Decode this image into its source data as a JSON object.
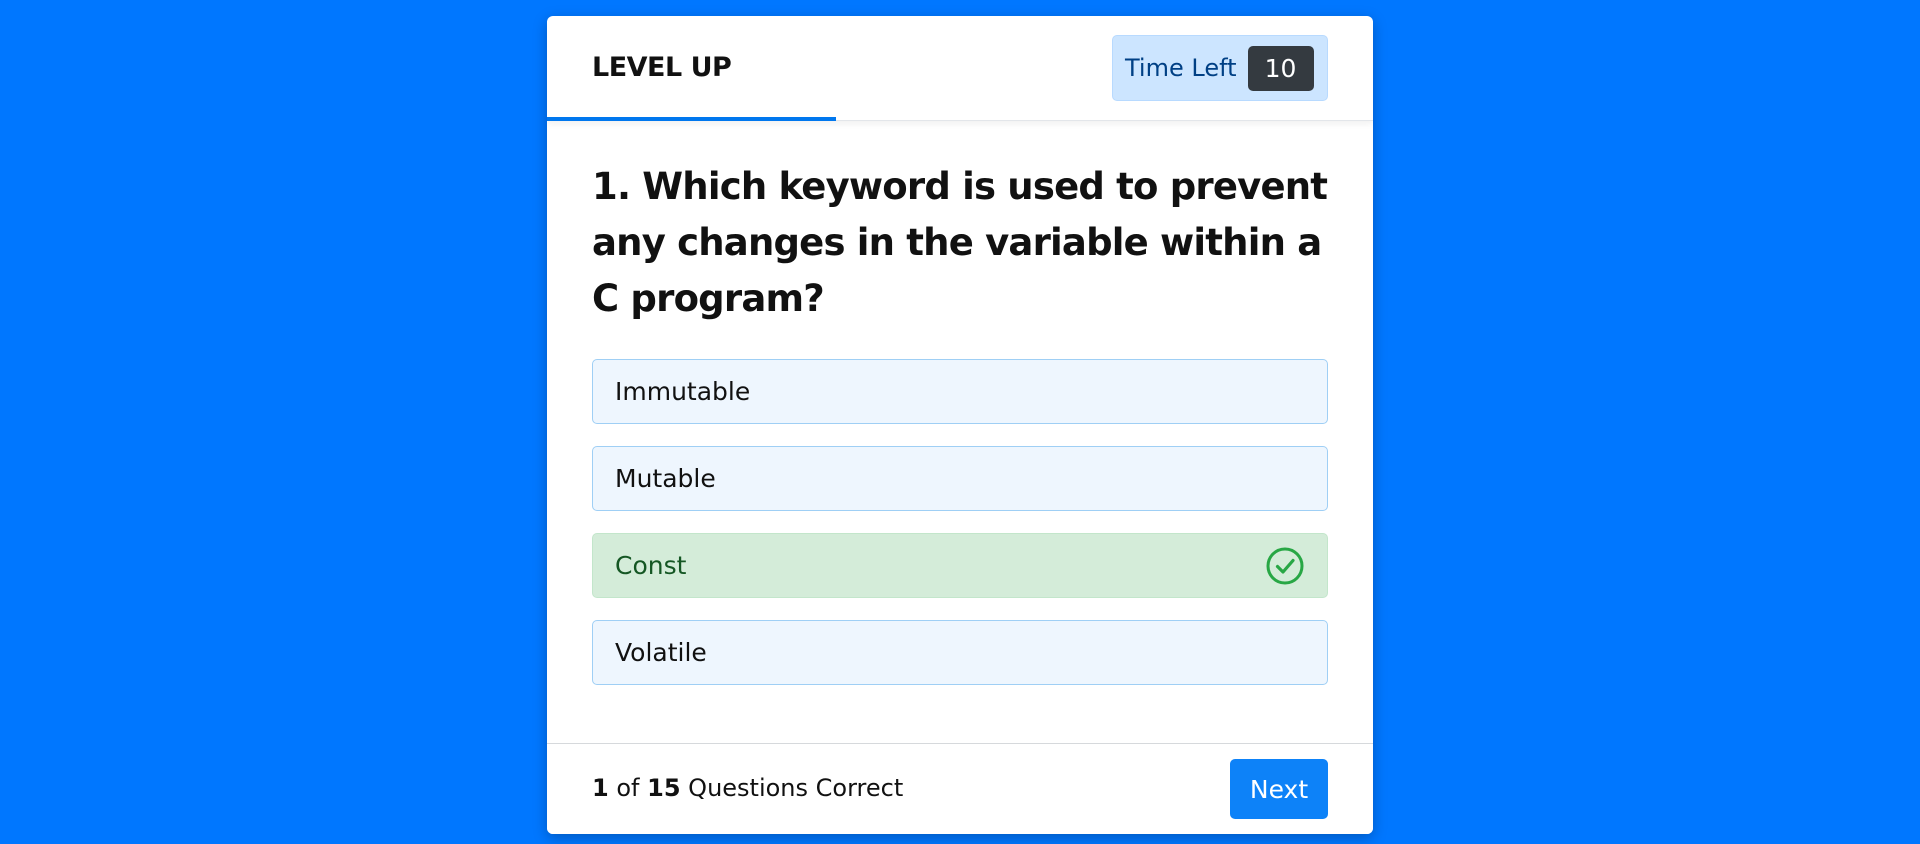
{
  "header": {
    "brand": "LEVEL UP",
    "timer_label": "Time Left",
    "timer_value": "10",
    "time_progress_fraction": 0.35
  },
  "question": {
    "text": "1. Which keyword is used to prevent any changes in the variable within a C program?"
  },
  "options": [
    {
      "label": "Immutable",
      "state": "default"
    },
    {
      "label": "Mutable",
      "state": "default"
    },
    {
      "label": "Const",
      "state": "correct",
      "icon": "check-circle-icon"
    },
    {
      "label": "Volatile",
      "state": "default"
    }
  ],
  "footer": {
    "score_correct": "1",
    "score_of": "of",
    "score_total": "15",
    "score_suffix": "Questions Correct",
    "next_label": "Next"
  },
  "colors": {
    "background": "#0077ff",
    "accent": "#0d82f8",
    "correct_bg": "#d4ecd9",
    "correct_text": "#155724",
    "correct_icon": "#28a745",
    "timer_bg": "#cce5ff",
    "timer_badge": "#343a40"
  }
}
